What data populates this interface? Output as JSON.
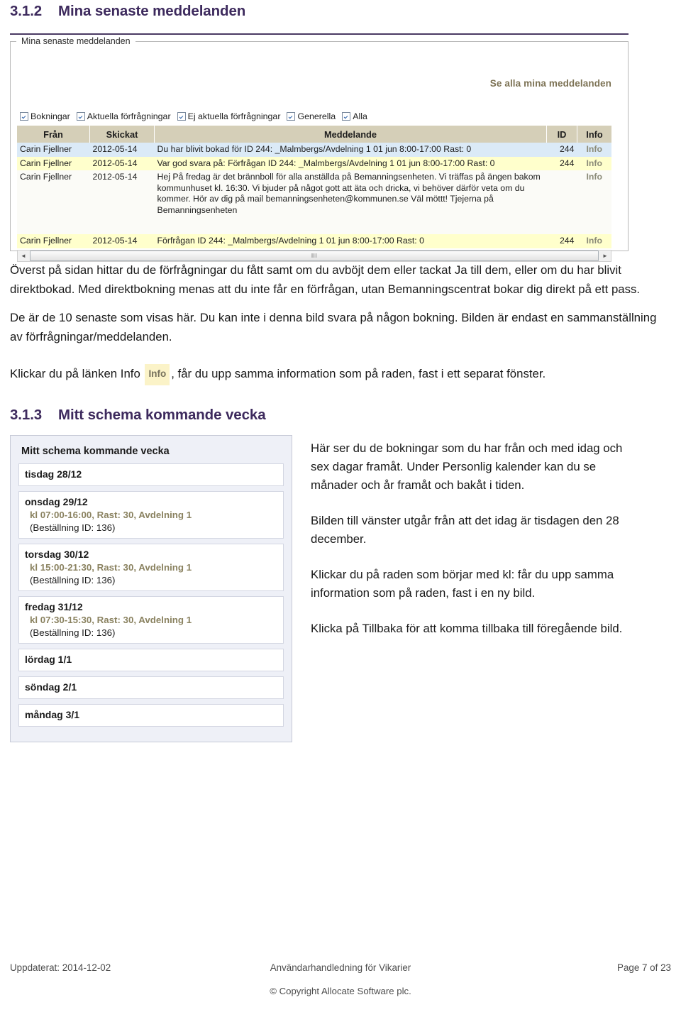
{
  "section_1": {
    "number": "3.1.2",
    "title": "Mina senaste meddelanden"
  },
  "messages_screenshot": {
    "groupbox_legend": "Mina senaste meddelanden",
    "see_all_link": "Se alla mina meddelanden",
    "filters": [
      {
        "label": "Bokningar",
        "checked": true
      },
      {
        "label": "Aktuella förfrågningar",
        "checked": true
      },
      {
        "label": "Ej aktuella förfrågningar",
        "checked": true
      },
      {
        "label": "Generella",
        "checked": true
      },
      {
        "label": "Alla",
        "checked": true
      }
    ],
    "table": {
      "columns": [
        "Från",
        "Skickat",
        "Meddelande",
        "ID",
        "Info"
      ],
      "rows": [
        {
          "from": "Carin Fjellner",
          "sent": "2012-05-14",
          "message": "Du har blivit bokad för ID 244: _Malmbergs/Avdelning 1 01 jun 8:00-17:00 Rast: 0",
          "id": "244",
          "info": "Info",
          "style": "blue"
        },
        {
          "from": "Carin Fjellner",
          "sent": "2012-05-14",
          "message": "Var god svara på: Förfrågan ID 244: _Malmbergs/Avdelning 1 01 jun 8:00-17:00 Rast: 0",
          "id": "244",
          "info": "Info",
          "style": "yellow"
        },
        {
          "from": "Carin Fjellner",
          "sent": "2012-05-14",
          "message": "Hej På fredag är det brännboll för alla anställda på Bemanningsenheten. Vi träffas på ängen bakom kommunhuset kl. 16:30. Vi bjuder på något gott att äta och dricka, vi behöver därför veta om du kommer. Hör av dig på mail bemanningsenheten@kommunen.se Väl möttt! Tjejerna på Bemanningsenheten",
          "id": "",
          "info": "Info",
          "style": "white"
        },
        {
          "from": "Carin Fjellner",
          "sent": "2012-05-14",
          "message": "Förfrågan ID 244: _Malmbergs/Avdelning 1 01 jun 8:00-17:00 Rast: 0",
          "id": "244",
          "info": "Info",
          "style": "yellow"
        }
      ]
    },
    "scrollbar": {
      "left_arrow": "◄",
      "right_arrow": "►",
      "grip": "III"
    }
  },
  "body": {
    "paragraph_1": "Överst på sidan hittar du de förfrågningar du fått samt om du avböjt dem eller tackat Ja till dem, eller om du har blivit direktbokad. Med direktbokning menas att du inte får en förfrågan, utan Bemanningscentrat bokar dig direkt på ett pass.",
    "paragraph_2": "De är de 10 senaste som visas här. Du kan inte i denna bild svara på någon bokning. Bilden är endast en sammanställning av förfrågningar/meddelanden.",
    "paragraph_3_before": "Klickar du på länken Info",
    "paragraph_3_badge": "Info",
    "paragraph_3_after": ", får du upp samma information som på raden, fast i ett separat fönster."
  },
  "section_2": {
    "number": "3.1.3",
    "title": "Mitt schema kommande vecka"
  },
  "schema_screenshot": {
    "panel_title": "Mitt schema kommande vecka",
    "days": [
      {
        "name": "tisdag 28/12",
        "time": "",
        "order": ""
      },
      {
        "name": "onsdag 29/12",
        "time": "kl 07:00-16:00, Rast: 30, Avdelning 1",
        "order": "(Beställning ID: 136)"
      },
      {
        "name": "torsdag 30/12",
        "time": "kl 15:00-21:30, Rast: 30, Avdelning 1",
        "order": "(Beställning ID: 136)"
      },
      {
        "name": "fredag 31/12",
        "time": "kl 07:30-15:30, Rast: 30, Avdelning 1",
        "order": "(Beställning ID: 136)"
      },
      {
        "name": "lördag 1/1",
        "time": "",
        "order": ""
      },
      {
        "name": "söndag 2/1",
        "time": "",
        "order": ""
      },
      {
        "name": "måndag 3/1",
        "time": "",
        "order": ""
      }
    ]
  },
  "notes": {
    "note_1": "Här ser du de bokningar som du har från och med idag och sex dagar framåt. Under Personlig kalender kan du se månader och år framåt och bakåt i tiden.",
    "note_2": "Bilden till vänster utgår från att det idag är tisdagen den 28 december.",
    "note_3": "Klickar du på raden som börjar med kl: får du upp samma information som på raden, fast i en ny bild.",
    "note_4": "Klicka på Tillbaka för att komma tillbaka till föregående bild."
  },
  "footer": {
    "updated": "Uppdaterat: 2014-12-02",
    "doc_title": "Användarhandledning för Vikarier",
    "page": "Page 7 of 23",
    "copyright": "© Copyright Allocate Software plc."
  }
}
